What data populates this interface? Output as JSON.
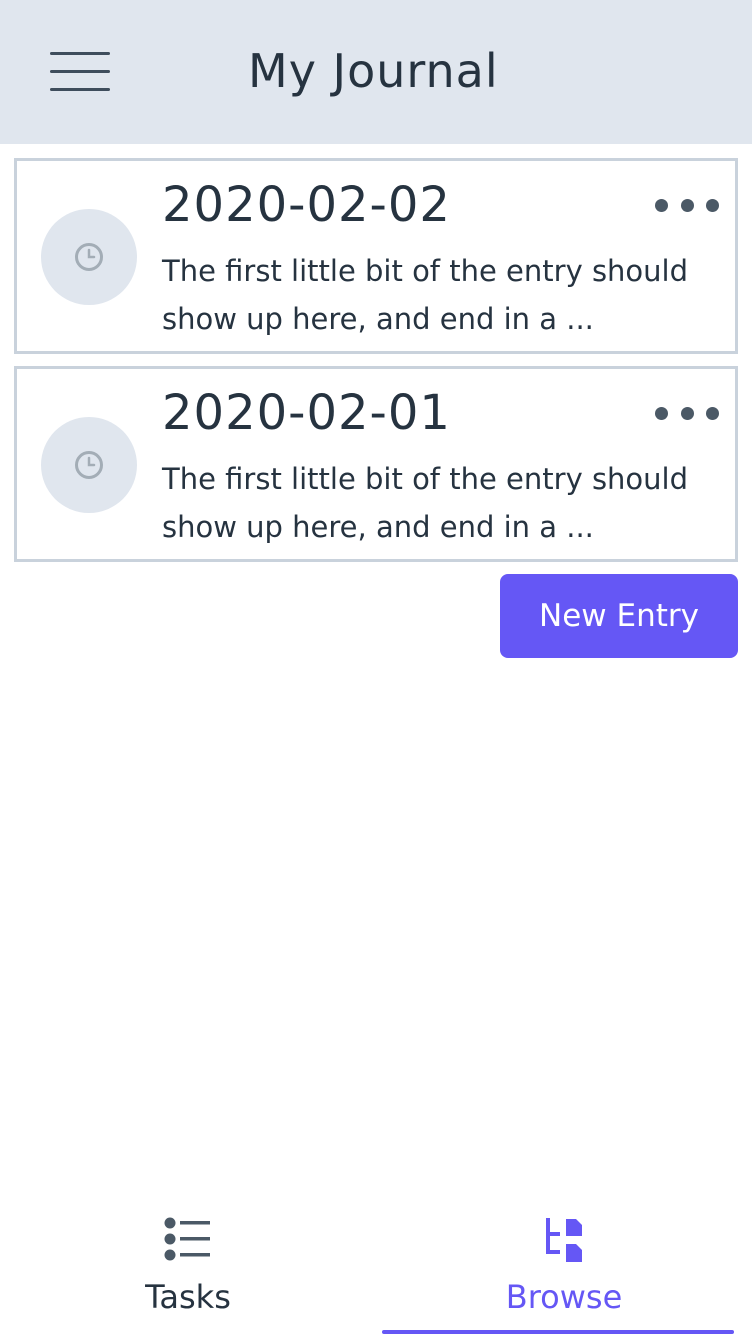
{
  "header": {
    "title": "My Journal"
  },
  "entries": [
    {
      "date": "2020-02-02",
      "excerpt": "The first little bit of the entry should show up here, and end in a ..."
    },
    {
      "date": "2020-02-01",
      "excerpt": "The first little bit of the entry should show up here, and end in a ..."
    }
  ],
  "actions": {
    "new_entry_label": "New Entry"
  },
  "bottom_nav": {
    "tasks_label": "Tasks",
    "browse_label": "Browse",
    "active_tab": "browse"
  },
  "icons": {
    "menu": "hamburger-icon",
    "entry_avatar": "clock-icon",
    "entry_more": "more-horizontal-icon",
    "tasks": "list-icon",
    "browse": "browse-tree-icon"
  },
  "colors": {
    "header_bg": "#e0e6ee",
    "accent": "#6557f5",
    "text": "#263340",
    "card_border": "#c9d2dc"
  }
}
